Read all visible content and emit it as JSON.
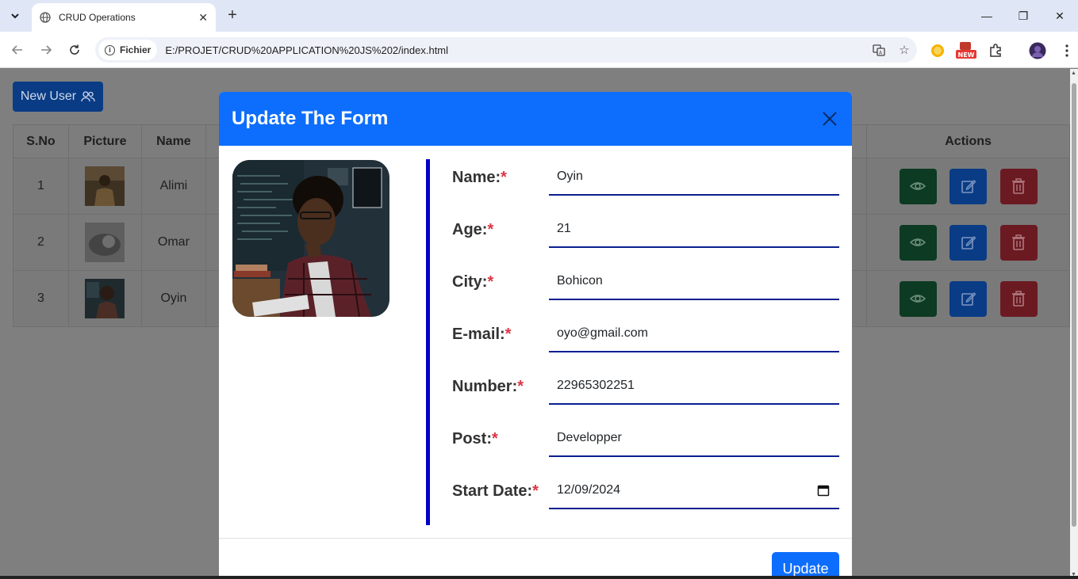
{
  "browser": {
    "tab_title": "CRUD Operations",
    "chip_label": "Fichier",
    "url": "E:/PROJET/CRUD%20APPLICATION%20JS%202/index.html",
    "new_badge": "NEW"
  },
  "page": {
    "new_user_label": "New User",
    "table": {
      "headers": [
        "S.No",
        "Picture",
        "Name",
        "Actions"
      ],
      "rows": [
        {
          "sno": "1",
          "name": "Alimi"
        },
        {
          "sno": "2",
          "name": "Omar"
        },
        {
          "sno": "3",
          "name": "Oyin"
        }
      ]
    }
  },
  "modal": {
    "title": "Update The Form",
    "required_mark": "*",
    "fields": [
      {
        "label": "Name:",
        "value": "Oyin"
      },
      {
        "label": "Age:",
        "value": "21"
      },
      {
        "label": "City:",
        "value": "Bohicon"
      },
      {
        "label": "E-mail:",
        "value": "oyo@gmail.com"
      },
      {
        "label": "Number:",
        "value": "22965302251"
      },
      {
        "label": "Post:",
        "value": "Developper"
      },
      {
        "label": "Start Date:",
        "value": "12/09/2024"
      }
    ],
    "update_label": "Update"
  },
  "colors": {
    "modal_header": "#0d6efd",
    "form_bar": "#0000c8",
    "required": "#dc3545"
  }
}
